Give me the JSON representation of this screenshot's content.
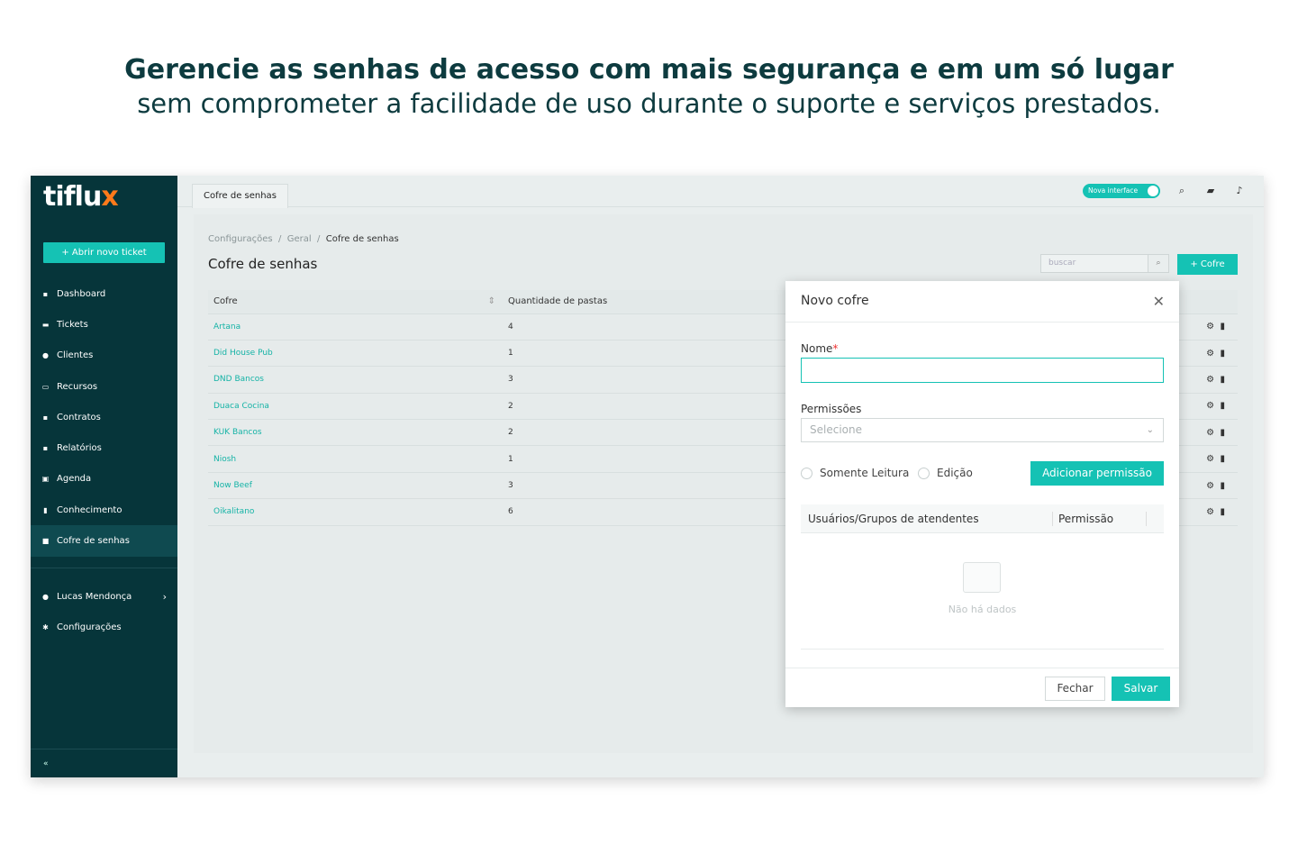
{
  "headline": {
    "title": "Gerencie as senhas de acesso com mais segurança e em um só lugar",
    "subtitle": "sem comprometer a facilidade de uso durante o suporte e serviços prestados."
  },
  "sidebar": {
    "logo": "tiflu",
    "logo_x": "x",
    "new_ticket": "+  Abrir novo ticket",
    "items": [
      {
        "label": "Dashboard",
        "icon": "dashboard-icon"
      },
      {
        "label": "Tickets",
        "icon": "ticket-icon"
      },
      {
        "label": "Clientes",
        "icon": "users-icon"
      },
      {
        "label": "Recursos",
        "icon": "monitor-icon"
      },
      {
        "label": "Contratos",
        "icon": "contract-icon"
      },
      {
        "label": "Relatórios",
        "icon": "report-icon"
      },
      {
        "label": "Agenda",
        "icon": "calendar-icon"
      },
      {
        "label": "Conhecimento",
        "icon": "book-icon"
      },
      {
        "label": "Cofre de senhas",
        "icon": "lock-icon"
      }
    ],
    "user": "Lucas Mendonça",
    "settings": "Configurações",
    "collapse": "«"
  },
  "topbar": {
    "tab": "Cofre de senhas",
    "toggle_label": "Nova interface"
  },
  "page": {
    "breadcrumb": [
      "Configurações",
      "Geral",
      "Cofre de senhas"
    ],
    "title": "Cofre de senhas",
    "search_placeholder": "buscar",
    "add_button": "+  Cofre"
  },
  "table": {
    "headers": [
      "Cofre",
      "Quantidade de pastas"
    ],
    "rows": [
      {
        "name": "Artana",
        "count": "4"
      },
      {
        "name": "Did House Pub",
        "count": "1"
      },
      {
        "name": "DND Bancos",
        "count": "3"
      },
      {
        "name": "Duaca Cocina",
        "count": "2"
      },
      {
        "name": "KUK Bancos",
        "count": "2"
      },
      {
        "name": "Niosh",
        "count": "1"
      },
      {
        "name": "Now Beef",
        "count": "3"
      },
      {
        "name": "Oikalitano",
        "count": "6"
      }
    ]
  },
  "modal": {
    "title": "Novo cofre",
    "name_label": "Nome",
    "required_mark": "*",
    "name_value": "",
    "permissions_label": "Permissões",
    "select_placeholder": "Selecione",
    "radio_read": "Somente Leitura",
    "radio_edit": "Edição",
    "add_permission": "Adicionar permissão",
    "col_users": "Usuários/Grupos de atendentes",
    "col_permission": "Permissão",
    "empty": "Não há dados",
    "close_button": "Fechar",
    "save_button": "Salvar"
  },
  "colors": {
    "accent": "#15c2b4",
    "sidebar": "#06353a",
    "logo_x": "#ff7a1a",
    "heading": "#0d3b3f"
  }
}
